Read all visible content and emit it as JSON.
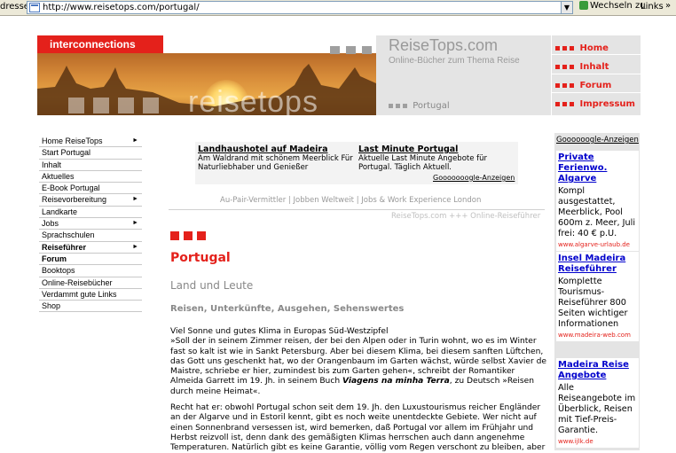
{
  "browser": {
    "address_label": "dresse",
    "url": "http://www.reisetops.com/portugal/",
    "go_label": "Wechseln zu",
    "links_label": "Links",
    "links_chevron": "»"
  },
  "header": {
    "tab_label": "interconnections",
    "site_title": "ReiseTops.com",
    "site_subtitle": "Online-Bücher zum Thema Reise",
    "wordmark": "reisetops",
    "breadcrumb": "Portugal",
    "nav": [
      "Home",
      "Inhalt",
      "Forum",
      "Impressum"
    ]
  },
  "leftnav": [
    {
      "label": "Home ReiseTops",
      "arrow": true,
      "bold": false
    },
    {
      "label": "Start Portugal",
      "arrow": false,
      "bold": false
    },
    {
      "label": "Inhalt",
      "arrow": false,
      "bold": false
    },
    {
      "label": "Aktuelles",
      "arrow": false,
      "bold": false
    },
    {
      "label": "E-Book Portugal",
      "arrow": false,
      "bold": false
    },
    {
      "label": "Reisevorbereitung",
      "arrow": true,
      "bold": false
    },
    {
      "label": "Landkarte",
      "arrow": false,
      "bold": false
    },
    {
      "label": "Jobs",
      "arrow": true,
      "bold": false
    },
    {
      "label": "Sprachschulen",
      "arrow": false,
      "bold": false
    },
    {
      "label": "Reiseführer",
      "arrow": true,
      "bold": true
    },
    {
      "label": "Forum",
      "arrow": false,
      "bold": true
    },
    {
      "label": "Booktops",
      "arrow": false,
      "bold": false
    },
    {
      "label": "Online-Reisebücher",
      "arrow": false,
      "bold": false
    },
    {
      "label": "Verdammt gute Links",
      "arrow": false,
      "bold": false
    },
    {
      "label": "Shop",
      "arrow": false,
      "bold": false
    }
  ],
  "ads_top": {
    "ad1_title": "Landhaushotel auf Madeira",
    "ad1_text": "Am Waldrand mit schönem Meerblick Für Naturliebhaber und Genießer",
    "ad2_title": "Last Minute Portugal",
    "ad2_text": "Aktuelle Last Minute Angebote für Portugal. Täglich Aktuell.",
    "google": "Gooooooogle-Anzeigen"
  },
  "content": {
    "links_row": "Au-Pair-Vermittler | Jobben Weltweit | Jobs & Work Experience London",
    "tagline": "ReiseTops.com +++ Online-Reiseführer",
    "title": "Portugal",
    "subtitle": "Land und Leute",
    "subtitle2": "Reisen, Unterkünfte, Ausgehen, Sehenswertes",
    "p1_line1": "Viel Sonne und gutes Klima in Europas Süd-Westzipfel",
    "p1_rest": "»Soll der in seinem Zimmer reisen, der bei den Alpen oder in Turin wohnt, wo es im Winter fast so kalt ist wie in Sankt Petersburg. Aber bei diesem Klima, bei diesem sanften Lüftchen, das Gott uns geschenkt hat, wo der Orangenbaum im Garten wächst, würde selbst Xavier de Maistre, schriebe er hier, zumindest bis zum Garten gehen«, schreibt der Romantiker Almeida Garrett im 19. Jh. in seinem Buch ",
    "p1_book": "Viagens na minha Terra",
    "p1_end": ", zu Deutsch »Reisen durch meine Heimat«.",
    "p2": "Recht hat er: obwohl Portugal schon seit dem 19. Jh. den Luxustourismus reicher Engländer an der Algarve und in Estoril kennt, gibt es noch weite unentdeckte Gebiete. Wer nicht auf einen Sonnenbrand versessen ist, wird bemerken, daß Portugal vor allem im Frühjahr und Herbst reizvoll ist, denn dank des gemäßigten Klimas herrschen auch dann angenehme Temperaturen. Natürlich gibt es keine Garantie, völlig vom Regen verschont zu bleiben, aber"
  },
  "ads_right": {
    "header": "Goooooogle-Anzeigen",
    "ads": [
      {
        "title": "Private Ferienwo. Algarve",
        "text": "Kompl ausgestattet, Meerblick, Pool 600m z. Meer, Juli frei: 40 € p.U.",
        "url": "www.algarve-urlaub.de"
      },
      {
        "title": "Insel Madeira Reiseführer",
        "text": "Komplette Tourismus-Reiseführer 800 Seiten wichtiger Informationen",
        "url": "www.madeira-web.com"
      },
      {
        "title": "Madeira Reise Angebote",
        "text": "Alle Reiseangebote im Überblick, Reisen mit Tief-Preis-Garantie.",
        "url": "www.ijlk.de"
      }
    ]
  },
  "colors": {
    "accent_red": "#e4211b",
    "panel_grey": "#e4e4e4",
    "link_blue": "#0000cc"
  }
}
